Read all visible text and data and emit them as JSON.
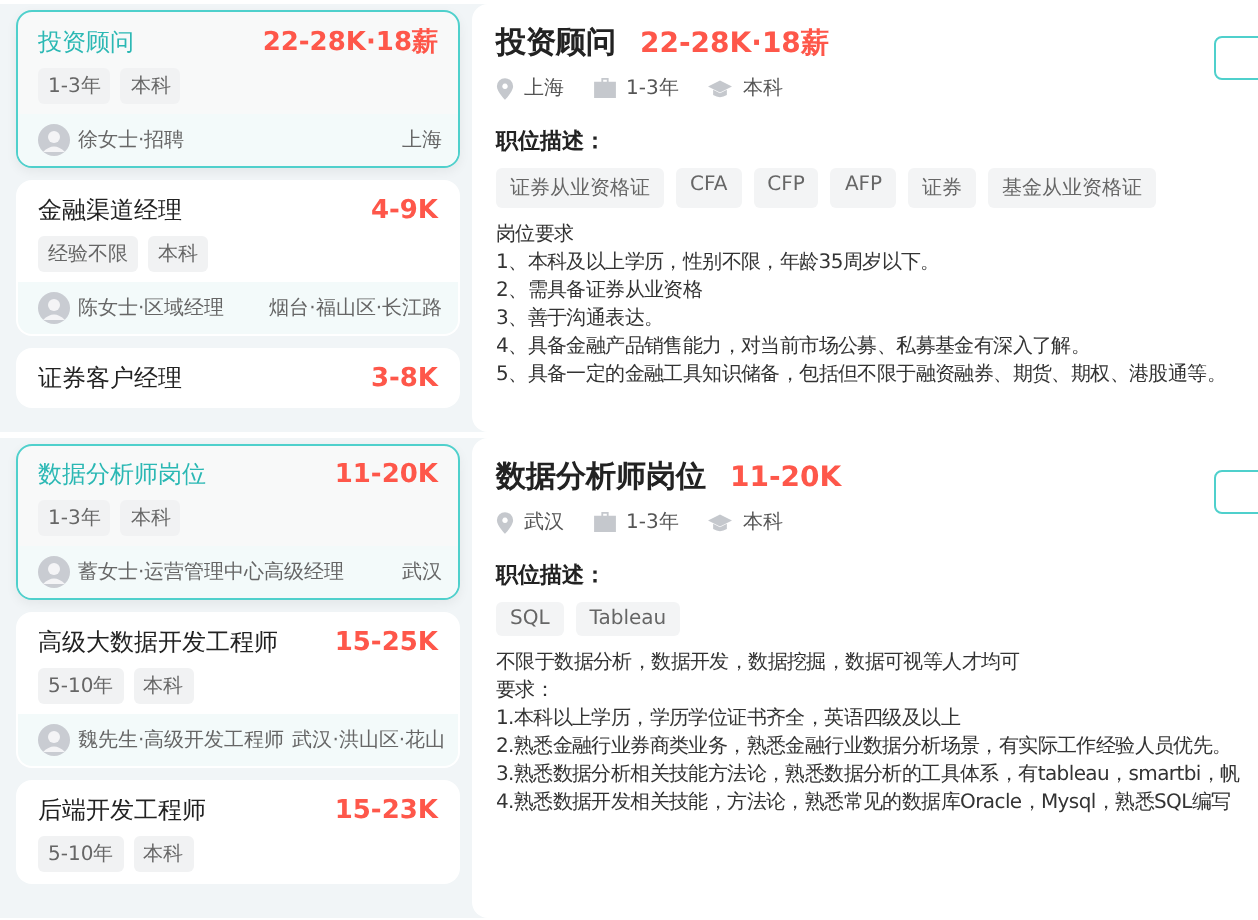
{
  "sections": [
    {
      "cards": [
        {
          "title": "投资顾问",
          "salary": "22-28K·18薪",
          "selected": true,
          "tags": [
            "1-3年",
            "本科"
          ],
          "recruiter": "徐女士·招聘",
          "location": "上海"
        },
        {
          "title": "金融渠道经理",
          "salary": "4-9K",
          "selected": false,
          "tags": [
            "经验不限",
            "本科"
          ],
          "recruiter": "陈女士·区域经理",
          "location": "烟台·福山区·长江路"
        },
        {
          "title": "证券客户经理",
          "salary": "3-8K",
          "selected": false
        }
      ],
      "detail": {
        "title": "投资顾问",
        "salary": "22-28K·18薪",
        "location": "上海",
        "experience": "1-3年",
        "education": "本科",
        "heading": "职位描述：",
        "skills": [
          "证券从业资格证",
          "CFA",
          "CFP",
          "AFP",
          "证券",
          "基金从业资格证"
        ],
        "lines": [
          "岗位要求",
          "1、本科及以上学历，性别不限，年龄35周岁以下。",
          "2、需具备证券从业资格",
          "3、善于沟通表达。",
          "4、具备金融产品销售能力，对当前市场公募、私募基金有深入了解。",
          "5、具备一定的金融工具知识储备，包括但不限于融资融券、期货、期权、港股通等。"
        ]
      }
    },
    {
      "cards": [
        {
          "title": "数据分析师岗位",
          "salary": "11-20K",
          "selected": true,
          "tags": [
            "1-3年",
            "本科"
          ],
          "recruiter": "蓄女士·运营管理中心高级经理",
          "location": "武汉"
        },
        {
          "title": "高级大数据开发工程师",
          "salary": "15-25K",
          "selected": false,
          "tags": [
            "5-10年",
            "本科"
          ],
          "recruiter": "魏先生·高级开发工程师",
          "location": "武汉·洪山区·花山"
        },
        {
          "title": "后端开发工程师",
          "salary": "15-23K",
          "selected": false,
          "tags": [
            "5-10年",
            "本科"
          ]
        }
      ],
      "detail": {
        "title": "数据分析师岗位",
        "salary": "11-20K",
        "location": "武汉",
        "experience": "1-3年",
        "education": "本科",
        "heading": "职位描述：",
        "skills": [
          "SQL",
          "Tableau"
        ],
        "lines": [
          "不限于数据分析，数据开发，数据挖掘，数据可视等人才均可",
          "要求：",
          "1.本科以上学历，学历学位证书齐全，英语四级及以上",
          "2.熟悉金融行业券商类业务，熟悉金融行业数据分析场景，有实际工作经验人员优先。",
          "3.熟悉数据分析相关技能方法论，熟悉数据分析的工具体系，有tableau，smartbi，帆",
          "4.熟悉数据开发相关技能，方法论，熟悉常见的数据库Oracle，Mysql，熟悉SQL编写"
        ]
      }
    }
  ]
}
